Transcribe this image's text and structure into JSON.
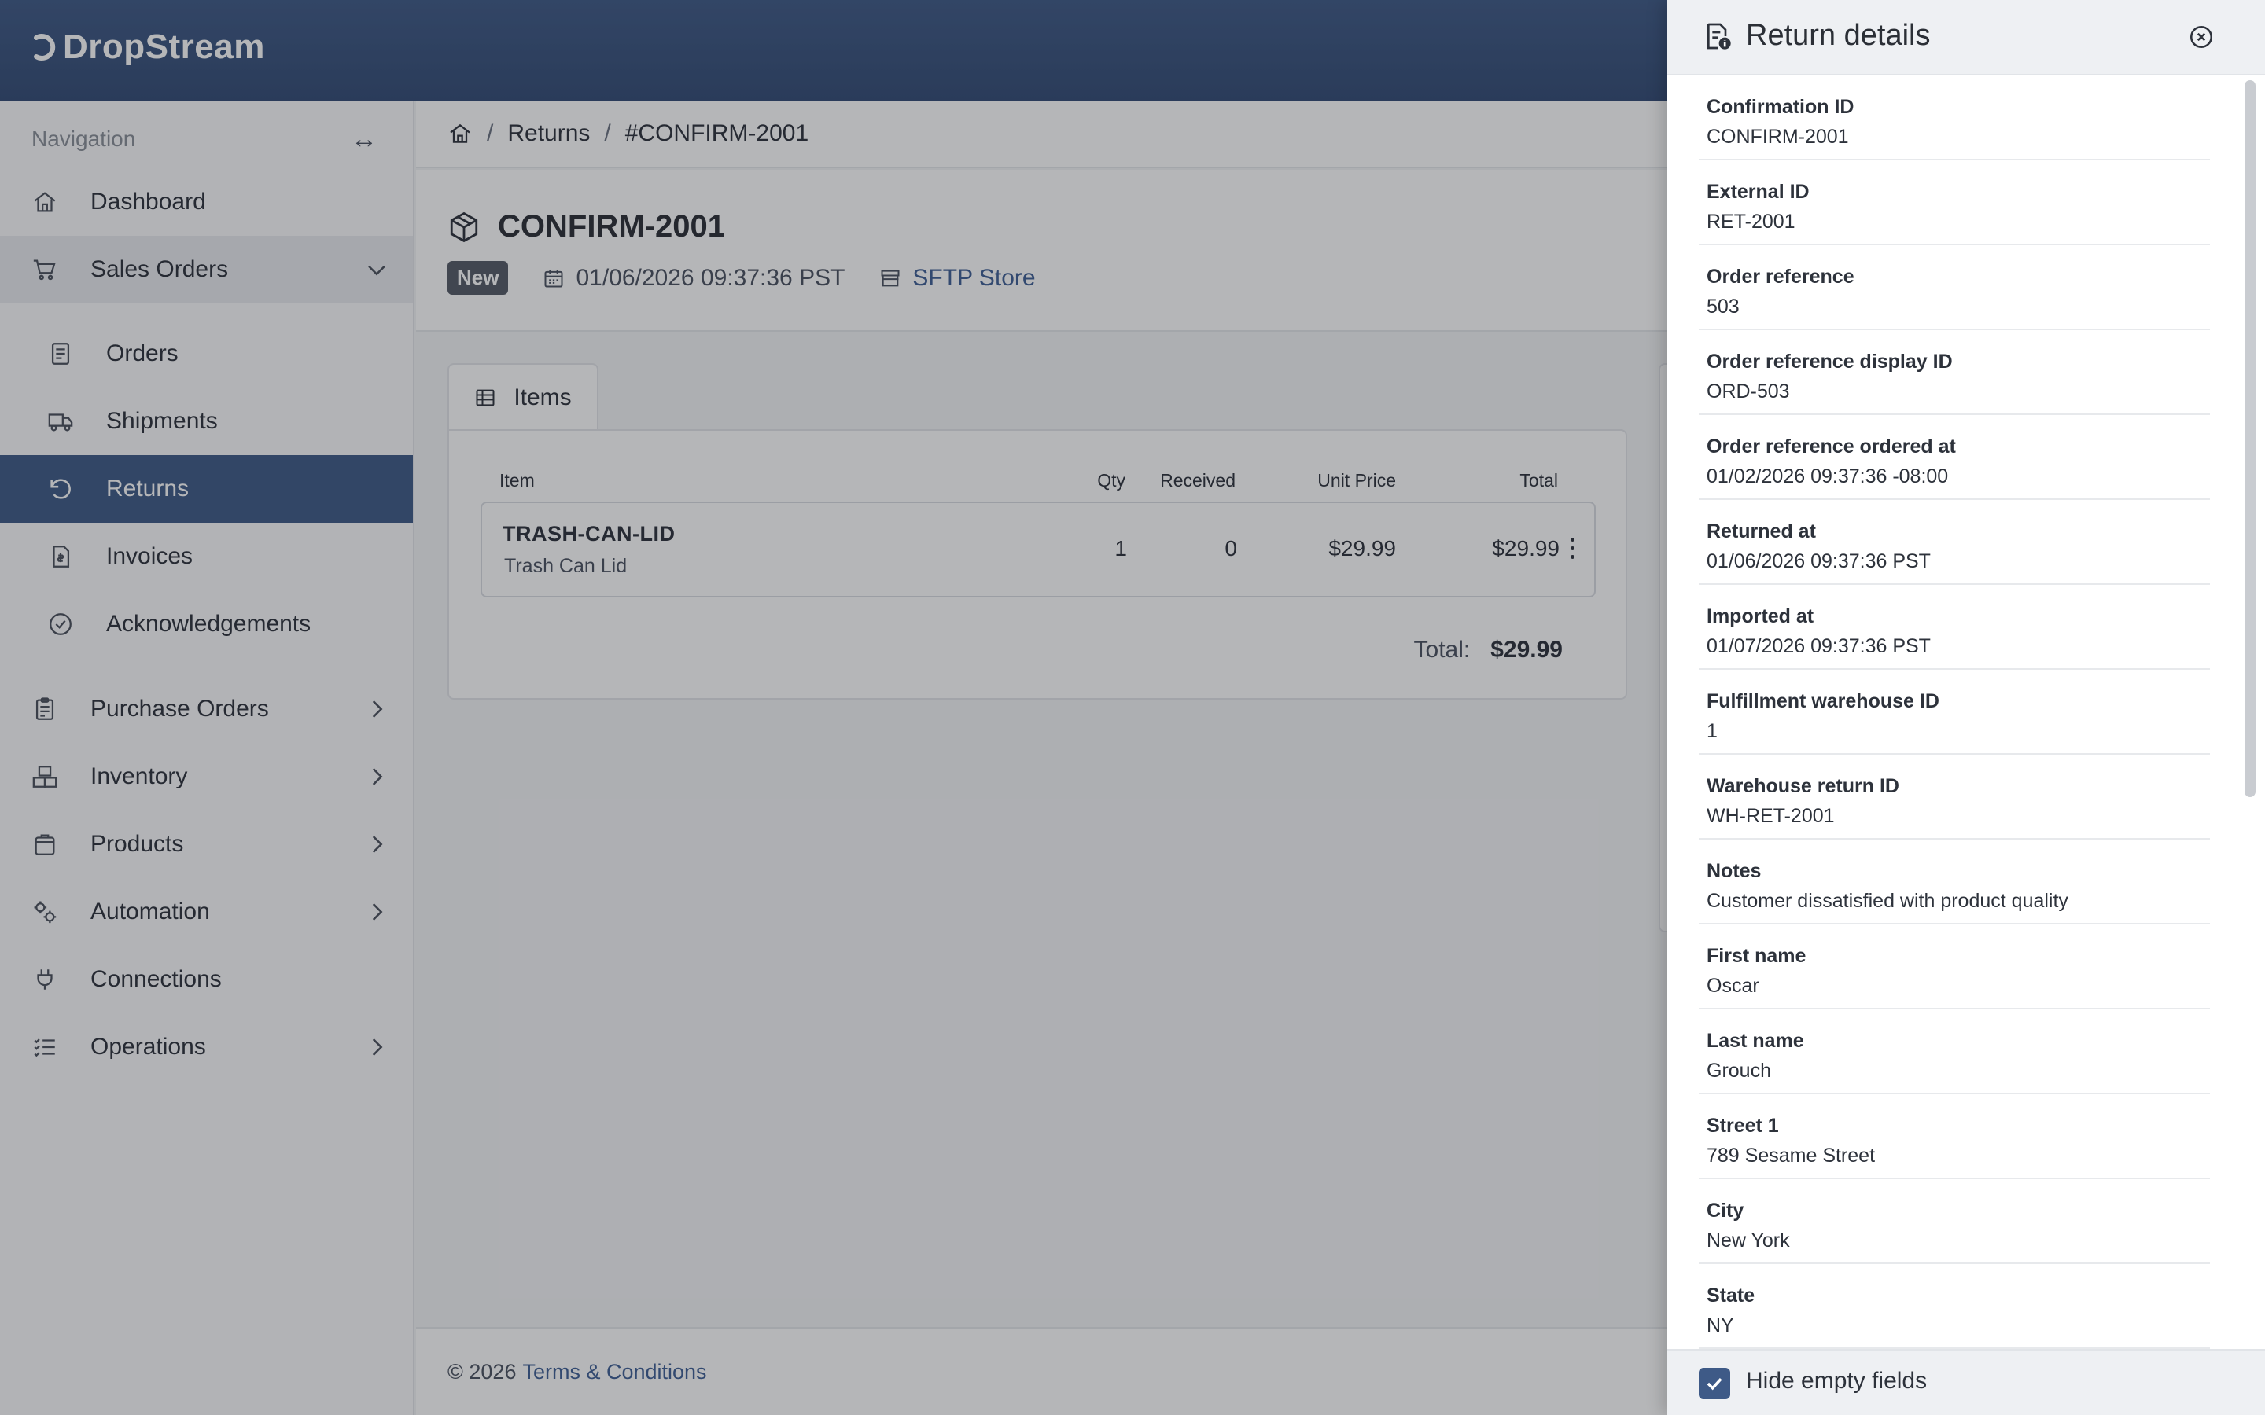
{
  "app": {
    "logo_text": "DropStream"
  },
  "sidebar": {
    "heading": "Navigation",
    "collapse_icon": "double-arrow-icon",
    "items": [
      {
        "label": "Dashboard",
        "icon": "home-icon"
      },
      {
        "label": "Sales Orders",
        "icon": "cart-icon",
        "expanded": true
      },
      {
        "label": "Purchase Orders",
        "icon": "clipboard-icon"
      },
      {
        "label": "Inventory",
        "icon": "boxes-icon"
      },
      {
        "label": "Products",
        "icon": "bag-icon"
      },
      {
        "label": "Automation",
        "icon": "gears-icon"
      },
      {
        "label": "Connections",
        "icon": "plug-icon"
      },
      {
        "label": "Operations",
        "icon": "list-icon"
      }
    ],
    "sub_items": [
      {
        "label": "Orders",
        "icon": "document-icon"
      },
      {
        "label": "Shipments",
        "icon": "truck-icon"
      },
      {
        "label": "Returns",
        "icon": "undo-icon",
        "active": true
      },
      {
        "label": "Invoices",
        "icon": "invoice-icon"
      },
      {
        "label": "Acknowledgements",
        "icon": "check-circle-icon"
      }
    ]
  },
  "breadcrumb": {
    "home_icon": "home-icon",
    "section": "Returns",
    "current": "#CONFIRM-2001"
  },
  "header": {
    "title": "CONFIRM-2001",
    "status": "New",
    "date": "01/06/2026 09:37:36 PST",
    "store": "SFTP Store"
  },
  "items_tab": {
    "label": "Items"
  },
  "items_table": {
    "columns": [
      "Item",
      "Qty",
      "Received",
      "Unit Price",
      "Total"
    ],
    "rows": [
      {
        "sku": "TRASH-CAN-LID",
        "name": "Trash Can Lid",
        "qty": "1",
        "received": "0",
        "unit_price": "$29.99",
        "total": "$29.99"
      }
    ],
    "total_label": "Total:",
    "total_value": "$29.99"
  },
  "footer": {
    "copyright": "© 2026",
    "link": "Terms & Conditions"
  },
  "drawer": {
    "title": "Return details",
    "fields": [
      {
        "label": "Confirmation ID",
        "value": "CONFIRM-2001"
      },
      {
        "label": "External ID",
        "value": "RET-2001"
      },
      {
        "label": "Order reference",
        "value": "503"
      },
      {
        "label": "Order reference display ID",
        "value": "ORD-503"
      },
      {
        "label": "Order reference ordered at",
        "value": "01/02/2026 09:37:36 -08:00"
      },
      {
        "label": "Returned at",
        "value": "01/06/2026 09:37:36 PST"
      },
      {
        "label": "Imported at",
        "value": "01/07/2026 09:37:36 PST"
      },
      {
        "label": "Fulfillment warehouse ID",
        "value": "1"
      },
      {
        "label": "Warehouse return ID",
        "value": "WH-RET-2001"
      },
      {
        "label": "Notes",
        "value": "Customer dissatisfied with product quality"
      },
      {
        "label": "First name",
        "value": "Oscar"
      },
      {
        "label": "Last name",
        "value": "Grouch"
      },
      {
        "label": "Street 1",
        "value": "789 Sesame Street"
      },
      {
        "label": "City",
        "value": "New York"
      },
      {
        "label": "State",
        "value": "NY"
      }
    ],
    "hide_empty_label": "Hide empty fields",
    "hide_empty_checked": true
  },
  "colors": {
    "brand": "#3e5a87",
    "link": "#3f5f95",
    "badge": "#555b66"
  }
}
